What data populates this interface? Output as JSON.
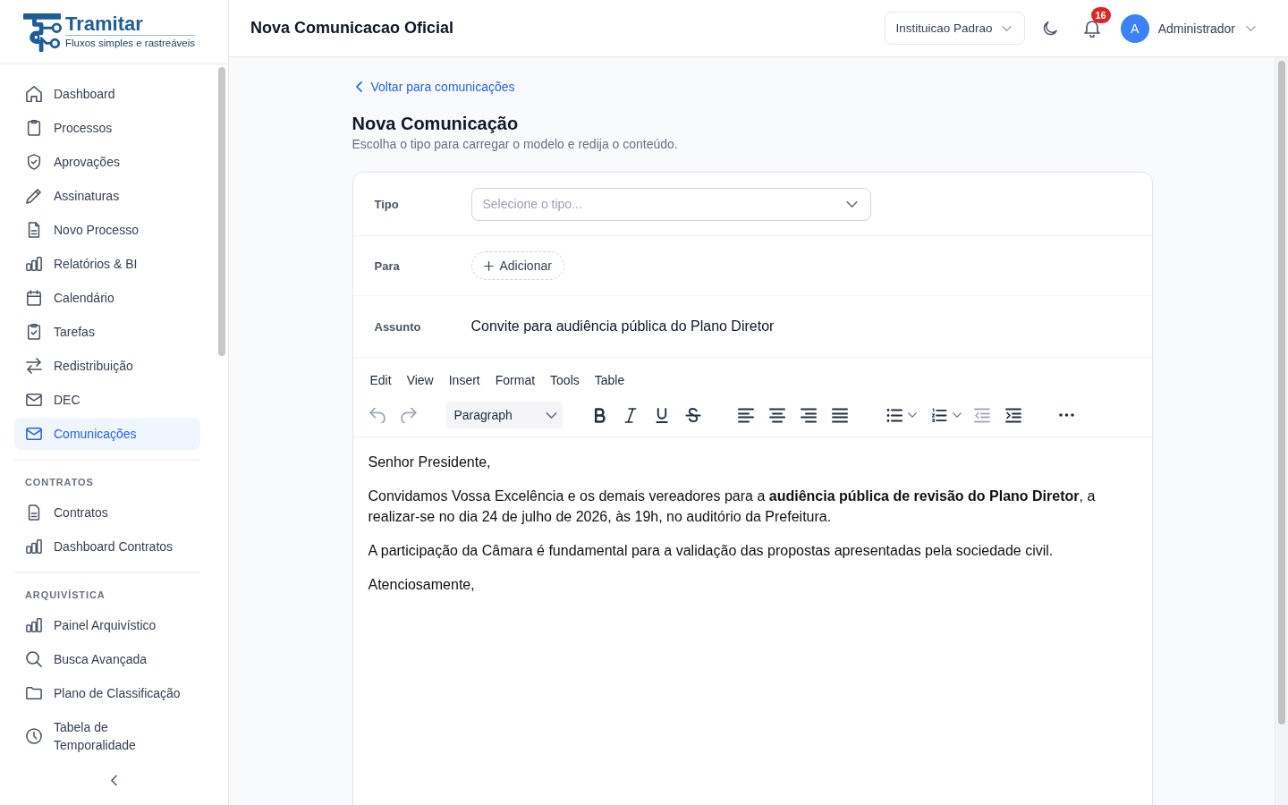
{
  "sidebar": {
    "logo": {
      "name": "Tramitar",
      "tagline": "Fluxos simples e rastreáveis"
    },
    "sections": [
      {
        "items": [
          {
            "label": "Dashboard",
            "selected": false
          },
          {
            "label": "Processos",
            "selected": false
          },
          {
            "label": "Aprovações",
            "selected": false
          },
          {
            "label": "Assinaturas",
            "selected": false
          },
          {
            "label": "Novo Processo",
            "selected": false
          },
          {
            "label": "Relatórios & BI",
            "selected": false
          },
          {
            "label": "Calendário",
            "selected": false
          },
          {
            "label": "Tarefas",
            "selected": false
          },
          {
            "label": "Redistribuição",
            "selected": false
          },
          {
            "label": "DEC",
            "selected": false
          },
          {
            "label": "Comunicações",
            "selected": true
          }
        ]
      },
      {
        "title": "CONTRATOS",
        "items": [
          {
            "label": "Contratos",
            "selected": false
          },
          {
            "label": "Dashboard Contratos",
            "selected": false
          }
        ]
      },
      {
        "title": "ARQUIVÍSTICA",
        "items": [
          {
            "label": "Painel Arquivístico",
            "selected": false
          },
          {
            "label": "Busca Avançada",
            "selected": false
          },
          {
            "label": "Plano de Classificação",
            "selected": false
          },
          {
            "label": "Tabela de Temporalidade",
            "selected": false
          }
        ]
      }
    ]
  },
  "header": {
    "title": "Nova Comunicacao Oficial",
    "institution": "Instituicao Padrao",
    "notifications": "16",
    "user": {
      "initial": "A",
      "name": "Administrador"
    }
  },
  "page": {
    "back_link": "Voltar para comunicações",
    "title": "Nova Comunicação",
    "subtitle": "Escolha o tipo para carregar o modelo e redija o conteúdo.",
    "form": {
      "tipo": {
        "label": "Tipo",
        "placeholder": "Selecione o tipo..."
      },
      "para": {
        "label": "Para",
        "add_button": "Adicionar"
      },
      "assunto": {
        "label": "Assunto",
        "value": "Convite para audiência pública do Plano Diretor"
      }
    },
    "editor": {
      "menu": [
        "Edit",
        "View",
        "Insert",
        "Format",
        "Tools",
        "Table"
      ],
      "block_format": "Paragraph",
      "toolbar": [
        {
          "disabled": true
        },
        {
          "disabled": true
        },
        {
          "disabled": false
        },
        {
          "disabled": false
        },
        {
          "disabled": false
        },
        {
          "disabled": false
        },
        {
          "disabled": false
        },
        {
          "disabled": false
        },
        {
          "disabled": false
        },
        {
          "disabled": false
        },
        {
          "disabled": false
        },
        {
          "disabled": false
        },
        {
          "disabled": true
        },
        {
          "disabled": false
        },
        {
          "disabled": false
        }
      ],
      "content": [
        "Senhor Presidente,",
        "Convidamos Vossa Excelência e os demais vereadores para a **audiência pública de revisão do Plano Diretor**, a realizar-se no dia 24 de julho de 2026, às 19h, no auditório da Prefeitura.",
        "A participação da Câmara é fundamental para a validação das propostas apresentadas pela sociedade civil.",
        "Atenciosamente,"
      ]
    }
  }
}
